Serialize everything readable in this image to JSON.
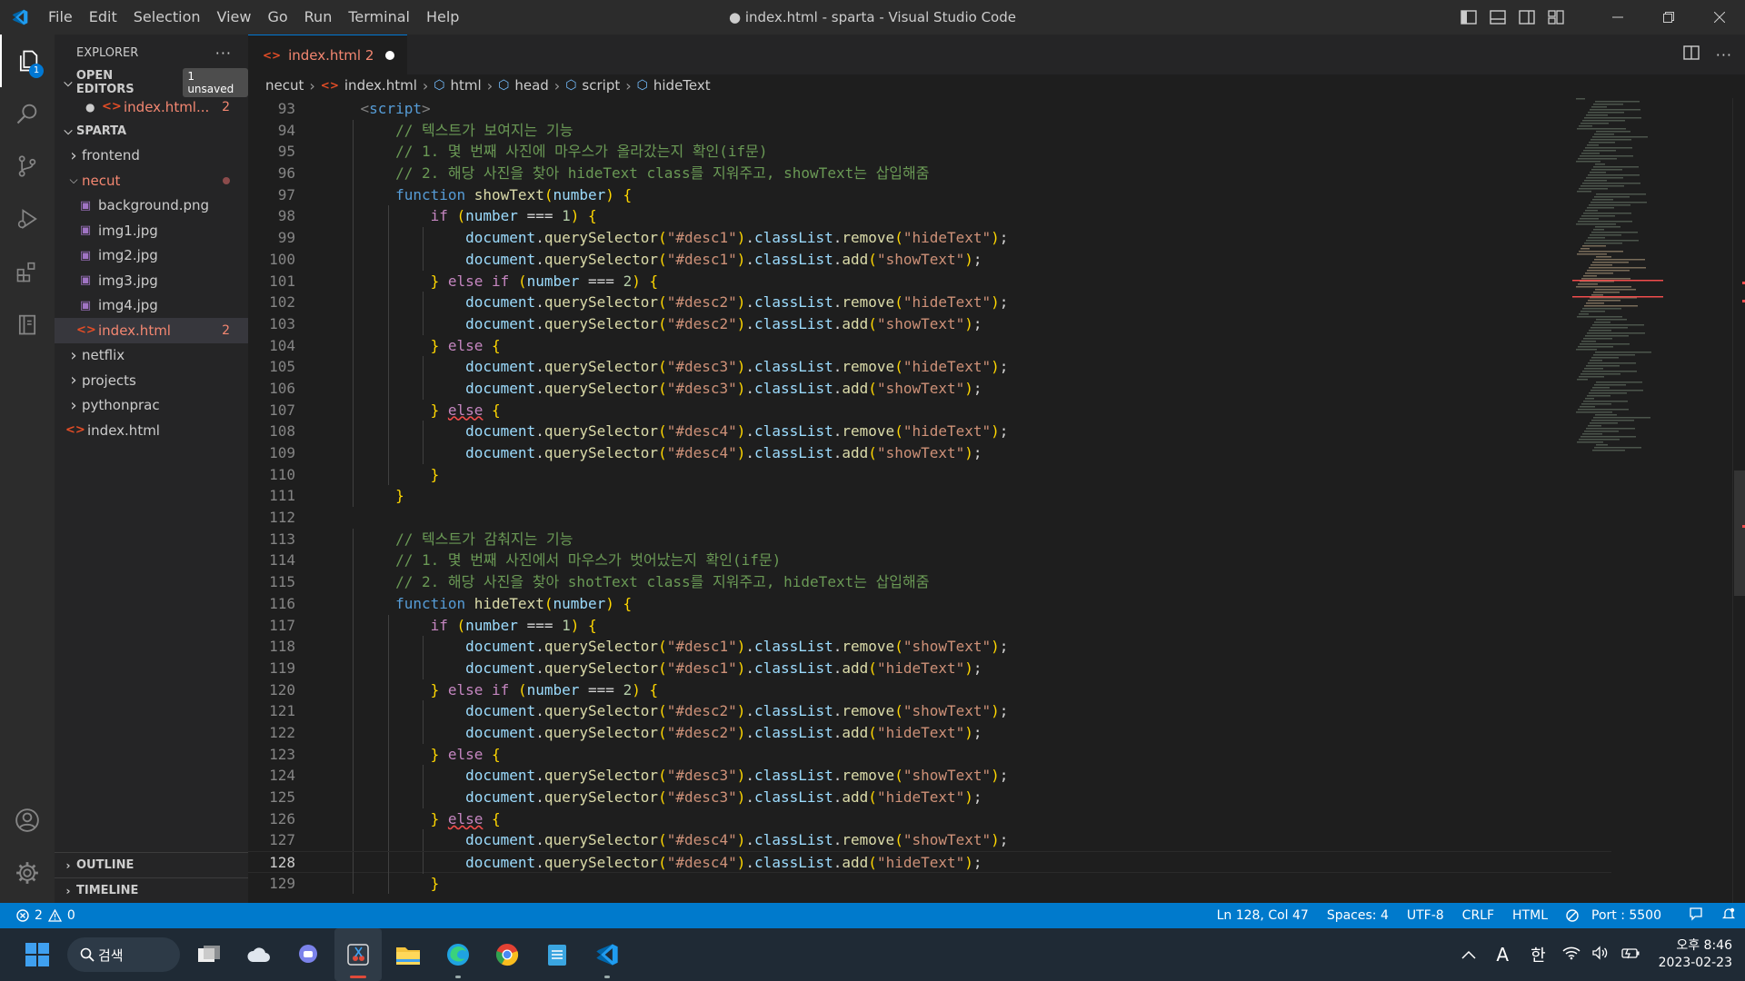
{
  "titlebar": {
    "menu": [
      "File",
      "Edit",
      "Selection",
      "View",
      "Go",
      "Run",
      "Terminal",
      "Help"
    ],
    "title": "● index.html - sparta - Visual Studio Code"
  },
  "activity": {
    "explorer_badge": "1"
  },
  "sidebar": {
    "header": "EXPLORER",
    "more": "···",
    "open_editors": {
      "label": "OPEN EDITORS",
      "unsaved": "1 unsaved",
      "file": "index.html...",
      "problems": "2"
    },
    "workspace": "SPARTA",
    "tree": [
      {
        "name": "frontend",
        "type": "folder",
        "depth": 0,
        "open": false
      },
      {
        "name": "necut",
        "type": "folder",
        "depth": 0,
        "open": true
      },
      {
        "name": "background.png",
        "type": "image",
        "depth": 1
      },
      {
        "name": "img1.jpg",
        "type": "image",
        "depth": 1
      },
      {
        "name": "img2.jpg",
        "type": "image",
        "depth": 1
      },
      {
        "name": "img3.jpg",
        "type": "image",
        "depth": 1
      },
      {
        "name": "img4.jpg",
        "type": "image",
        "depth": 1
      },
      {
        "name": "index.html",
        "type": "html",
        "depth": 1,
        "problems": "2"
      },
      {
        "name": "netflix",
        "type": "folder",
        "depth": 0,
        "open": false
      },
      {
        "name": "projects",
        "type": "folder",
        "depth": 0,
        "open": false
      },
      {
        "name": "pythonprac",
        "type": "folder",
        "depth": 0,
        "open": false
      },
      {
        "name": "index.html",
        "type": "html",
        "depth": 0
      }
    ],
    "outline": "OUTLINE",
    "timeline": "TIMELINE"
  },
  "editor": {
    "tab": {
      "label": "index.html 2"
    },
    "breadcrumb": [
      "necut",
      "index.html",
      "html",
      "head",
      "script",
      "hideText"
    ],
    "lines": [
      {
        "n": "93",
        "text": "    <script>"
      },
      {
        "n": "94",
        "text": "        // 텍스트가 보여지는 기능"
      },
      {
        "n": "95",
        "text": "        // 1. 몇 번째 사진에 마우스가 올라갔는지 확인(if문)"
      },
      {
        "n": "96",
        "text": "        // 2. 해당 사진을 찾아 hideText class를 지워주고, showText는 삽입해줌"
      },
      {
        "n": "97",
        "text": "        function showText(number) {"
      },
      {
        "n": "98",
        "text": "            if (number === 1) {"
      },
      {
        "n": "99",
        "text": "                document.querySelector(\"#desc1\").classList.remove(\"hideText\");"
      },
      {
        "n": "100",
        "text": "                document.querySelector(\"#desc1\").classList.add(\"showText\");"
      },
      {
        "n": "101",
        "text": "            } else if (number === 2) {"
      },
      {
        "n": "102",
        "text": "                document.querySelector(\"#desc2\").classList.remove(\"hideText\");"
      },
      {
        "n": "103",
        "text": "                document.querySelector(\"#desc2\").classList.add(\"showText\");"
      },
      {
        "n": "104",
        "text": "            } else {"
      },
      {
        "n": "105",
        "text": "                document.querySelector(\"#desc3\").classList.remove(\"hideText\");"
      },
      {
        "n": "106",
        "text": "                document.querySelector(\"#desc3\").classList.add(\"showText\");"
      },
      {
        "n": "107",
        "text": "            } else {"
      },
      {
        "n": "108",
        "text": "                document.querySelector(\"#desc4\").classList.remove(\"hideText\");"
      },
      {
        "n": "109",
        "text": "                document.querySelector(\"#desc4\").classList.add(\"showText\");"
      },
      {
        "n": "110",
        "text": "            }"
      },
      {
        "n": "111",
        "text": "        }"
      },
      {
        "n": "112",
        "text": ""
      },
      {
        "n": "113",
        "text": "        // 텍스트가 감춰지는 기능"
      },
      {
        "n": "114",
        "text": "        // 1. 몇 번째 사진에서 마우스가 벗어났는지 확인(if문)"
      },
      {
        "n": "115",
        "text": "        // 2. 해당 사진을 찾아 shotText class를 지워주고, hideText는 삽입해줌"
      },
      {
        "n": "116",
        "text": "        function hideText(number) {"
      },
      {
        "n": "117",
        "text": "            if (number === 1) {"
      },
      {
        "n": "118",
        "text": "                document.querySelector(\"#desc1\").classList.remove(\"showText\");"
      },
      {
        "n": "119",
        "text": "                document.querySelector(\"#desc1\").classList.add(\"hideText\");"
      },
      {
        "n": "120",
        "text": "            } else if (number === 2) {"
      },
      {
        "n": "121",
        "text": "                document.querySelector(\"#desc2\").classList.remove(\"showText\");"
      },
      {
        "n": "122",
        "text": "                document.querySelector(\"#desc2\").classList.add(\"hideText\");"
      },
      {
        "n": "123",
        "text": "            } else {"
      },
      {
        "n": "124",
        "text": "                document.querySelector(\"#desc3\").classList.remove(\"showText\");"
      },
      {
        "n": "125",
        "text": "                document.querySelector(\"#desc3\").classList.add(\"hideText\");"
      },
      {
        "n": "126",
        "text": "            } else {"
      },
      {
        "n": "127",
        "text": "                document.querySelector(\"#desc4\").classList.remove(\"showText\");"
      },
      {
        "n": "128",
        "text": "                document.querySelector(\"#desc4\").classList.add(\"hideText\");"
      },
      {
        "n": "129",
        "text": "            }"
      }
    ],
    "current_line": "128"
  },
  "status": {
    "errors": "2",
    "warnings": "0",
    "position": "Ln 128, Col 47",
    "spaces": "Spaces: 4",
    "encoding": "UTF-8",
    "eol": "CRLF",
    "language": "HTML",
    "port": "Port : 5500"
  },
  "taskbar": {
    "search": "검색",
    "ime_a": "A",
    "ime_han": "한",
    "time": "오후 8:46",
    "date": "2023-02-23"
  },
  "colors": {
    "accent": "#007acc",
    "error": "#f48771",
    "activity_bg": "#2c2c2c",
    "sidebar_bg": "#252526",
    "editor_bg": "#1e1e1e"
  }
}
